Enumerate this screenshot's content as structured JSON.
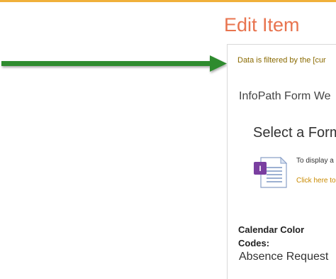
{
  "header": {
    "title": "Edit Item"
  },
  "content": {
    "filter_notice": "Data is filtered by the [cur",
    "infopath_title": "InfoPath Form We",
    "select_form_heading": "Select a Form",
    "display_text": "To display a",
    "click_link": "Click here to",
    "calendar_label_line1": "Calendar Color",
    "calendar_label_line2": "Codes:",
    "absence_text": "Absence Request"
  },
  "colors": {
    "title": "#e8744f",
    "accent_bar": "#f0b03a",
    "arrow": "#2e8b2e",
    "link": "#c98a00"
  },
  "icons": {
    "form": "infopath-form-icon",
    "arrow": "green-arrow-icon"
  }
}
